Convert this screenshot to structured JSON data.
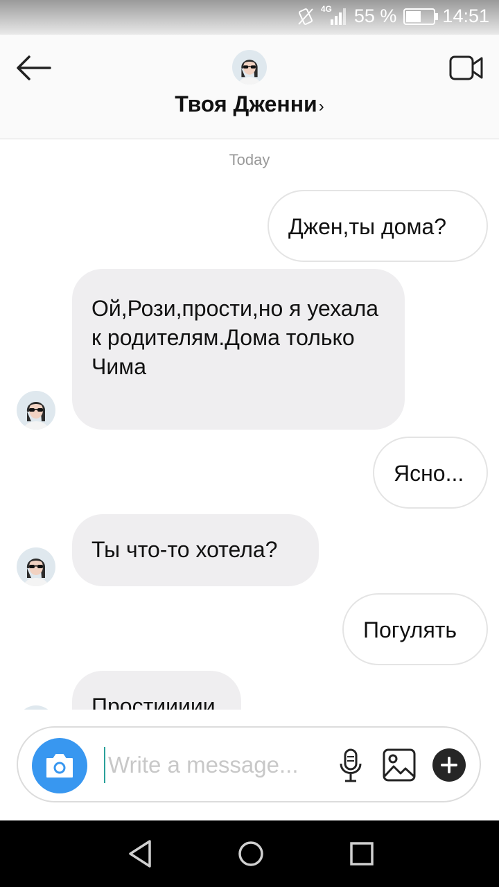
{
  "status_bar": {
    "network": "4G",
    "battery_percent": "55 %",
    "battery_level": 0.55,
    "time": "14:51"
  },
  "header": {
    "contact_name": "Твоя Дженни",
    "chevron": "›"
  },
  "chat": {
    "date_label": "Today",
    "messages": [
      {
        "direction": "outgoing",
        "text": "Джен,ты дома?"
      },
      {
        "direction": "incoming",
        "text": "Ой,Рози,прости,но я уехала к родителям.Дома только Чима"
      },
      {
        "direction": "outgoing",
        "text": "Ясно..."
      },
      {
        "direction": "incoming",
        "text": "Ты что-то хотела?"
      },
      {
        "direction": "outgoing",
        "text": "Погулять"
      },
      {
        "direction": "incoming",
        "text": "Простиииии"
      }
    ]
  },
  "composer": {
    "placeholder": "Write a message..."
  },
  "colors": {
    "camera_button": "#3897f0",
    "incoming_bubble": "#efeef0",
    "nav_bar": "#000000"
  },
  "icons": [
    "back-arrow-icon",
    "video-call-icon",
    "camera-icon",
    "microphone-icon",
    "gallery-icon",
    "plus-icon",
    "nav-back-icon",
    "nav-home-icon",
    "nav-recents-icon"
  ]
}
